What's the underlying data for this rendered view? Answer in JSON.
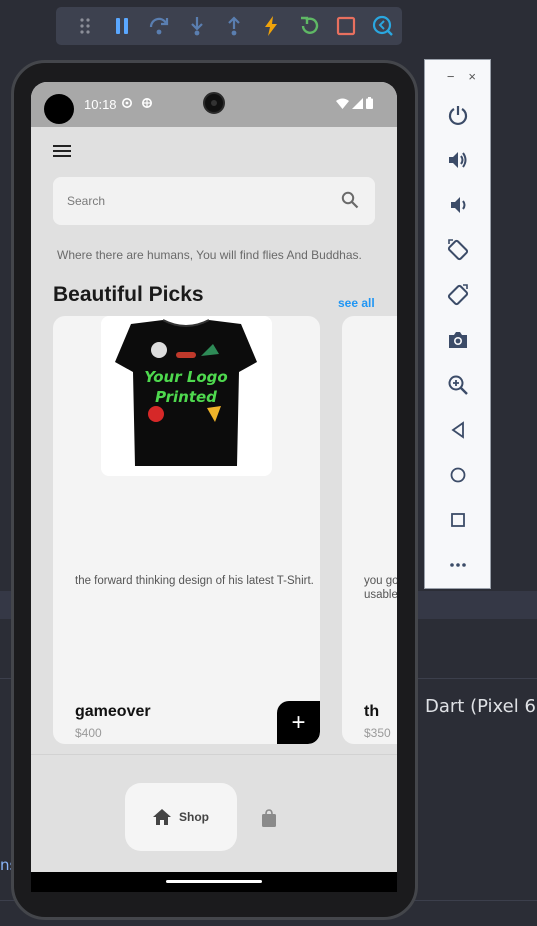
{
  "ide": {
    "status_text": "Dart (Pixel 6",
    "edge_text": "ns"
  },
  "debug_toolbar": {
    "buttons": [
      "drag-handle-icon",
      "pause-icon",
      "step-over-icon",
      "step-into-icon",
      "step-out-icon",
      "hot-reload-icon",
      "hot-restart-icon",
      "stop-icon",
      "devtools-icon"
    ]
  },
  "emulator_panel": {
    "minimize": "−",
    "close": "×"
  },
  "status_bar": {
    "time": "10:18"
  },
  "search": {
    "placeholder": "Search"
  },
  "quote": "Where there are humans, You will find flies And Buddhas.",
  "section": {
    "title": "Beautiful Picks",
    "see_all": "see all"
  },
  "products": [
    {
      "name": "gameover",
      "price": "$400",
      "description": "the forward thinking design of his latest T-Shirt.",
      "image_text_1": "Your Logo",
      "image_text_2": "Printed"
    },
    {
      "name": "th",
      "price": "$350",
      "description_line_1": "you go",
      "description_line_2": "usable"
    }
  ],
  "add_button": "+",
  "bottom_nav": {
    "shop_label": "Shop"
  },
  "colors": {
    "accent": "#2196f3",
    "ide_background": "#2b2d36"
  }
}
